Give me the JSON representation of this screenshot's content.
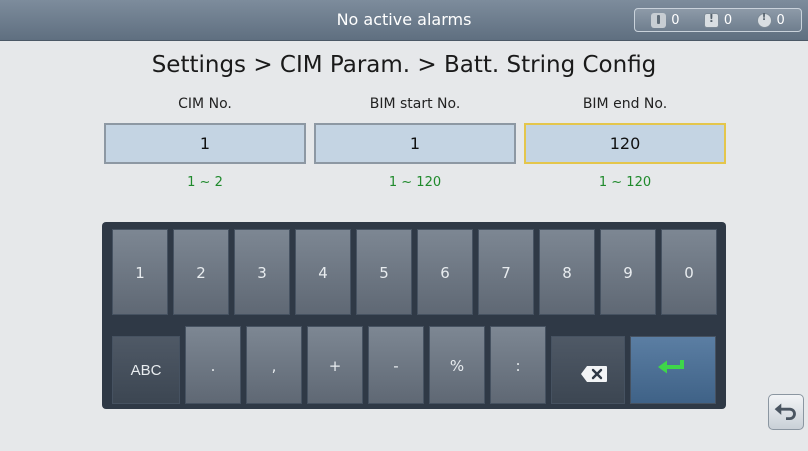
{
  "status_bar": {
    "alarm_text": "No active alarms",
    "alarm_counts": {
      "critical": "0",
      "major": "0",
      "minor": "0"
    }
  },
  "page": {
    "title": "Settings > CIM Param. > Batt. String Config"
  },
  "fields": [
    {
      "label": "CIM No.",
      "value": "1",
      "range": "1 ~ 2"
    },
    {
      "label": "BIM start No.",
      "value": "1",
      "range": "1 ~ 120"
    },
    {
      "label": "BIM end No.",
      "value": "120",
      "range": "1 ~ 120"
    }
  ],
  "keyboard": {
    "row1": [
      "1",
      "2",
      "3",
      "4",
      "5",
      "6",
      "7",
      "8",
      "9",
      "0"
    ],
    "row2": [
      "ABC",
      ".",
      ",",
      "+",
      "-",
      "%",
      ":"
    ],
    "icons": {
      "backspace": "backspace-icon",
      "enter": "enter-icon"
    }
  },
  "colors": {
    "range_text": "#1f8a2c",
    "active_field_border": "#e4c64c",
    "enter_key": "#3f6287"
  },
  "icons": {
    "critical_alarm": "critical-alarm-icon",
    "major_alarm": "major-alarm-icon",
    "minor_alarm": "minor-alarm-icon",
    "back": "back-arrow-icon"
  }
}
